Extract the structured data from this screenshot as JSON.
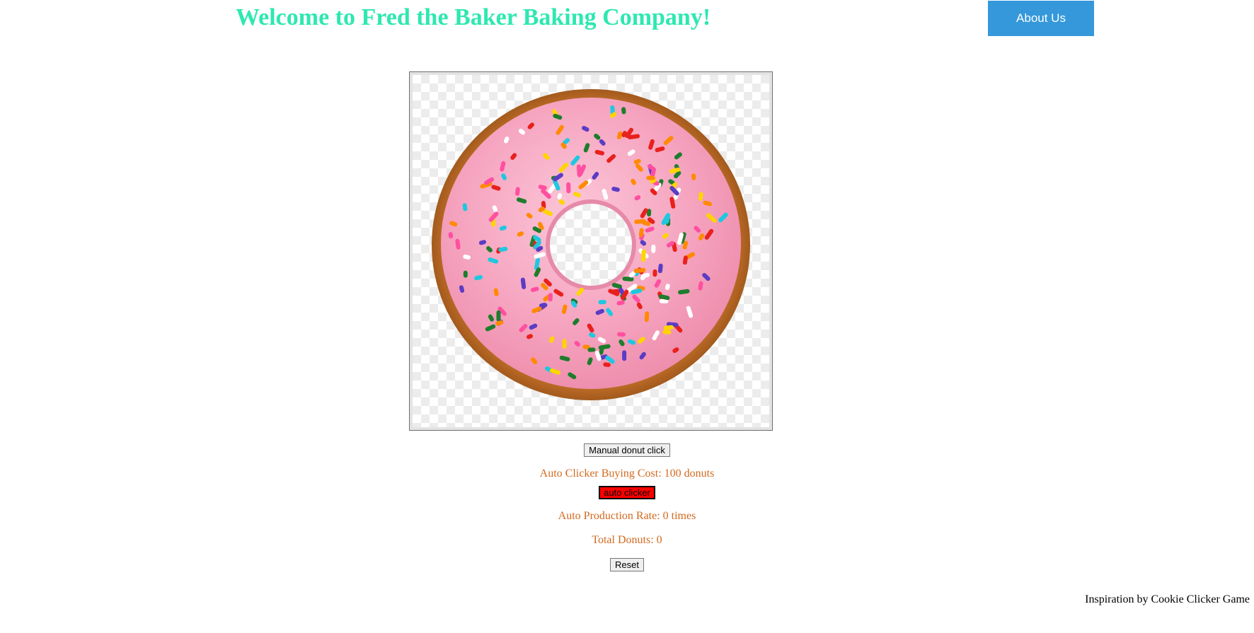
{
  "header": {
    "title": "Welcome to Fred the Baker Baking Company!",
    "about_label": "About Us"
  },
  "donut": {
    "icon": "donut-image",
    "colors": {
      "dough": "#c8742b",
      "frosting": "#f6a6c1",
      "sprinkles": [
        "#e8211c",
        "#ff8a00",
        "#ffd400",
        "#1e7d2c",
        "#5b3cc4",
        "#1ec8e0",
        "#ffffff",
        "#ff4fa0"
      ]
    }
  },
  "controls": {
    "manual_label": "Manual donut click",
    "auto_cost_text": "Auto Clicker Buying Cost: 100 donuts",
    "auto_label": "auto clicker",
    "rate_text": "Auto Production Rate: 0 times",
    "total_text": "Total Donuts: 0",
    "reset_label": "Reset"
  },
  "footer": {
    "credit": "Inspiration by Cookie Clicker Game"
  },
  "colors": {
    "title": "#2ee8b0",
    "about_button": "#3498db",
    "info_text": "#d2691e",
    "auto_button": "#ff0000"
  }
}
